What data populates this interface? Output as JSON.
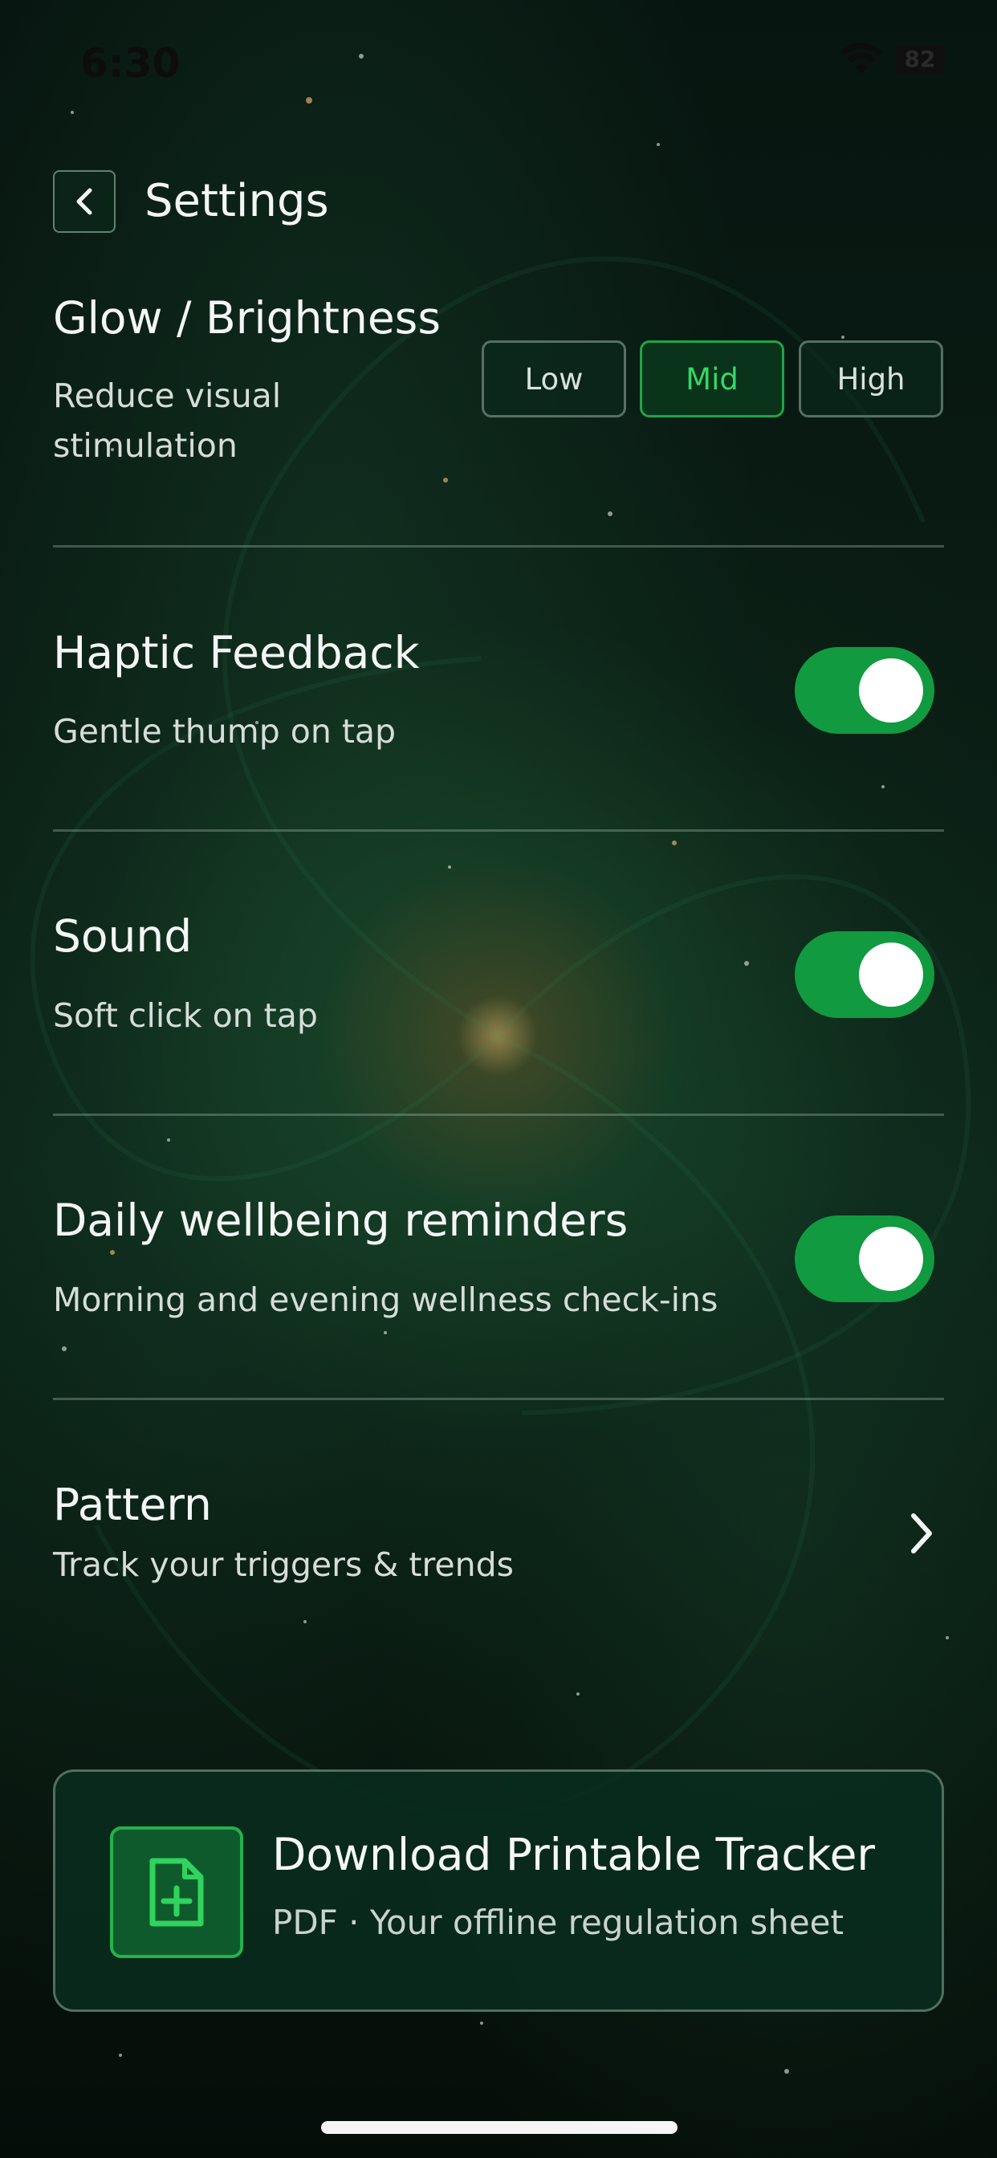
{
  "status_bar": {
    "time": "6:30",
    "battery": "82"
  },
  "header": {
    "title": "Settings"
  },
  "glow": {
    "title": "Glow / Brightness",
    "subtitle_line1": "Reduce visual",
    "subtitle_line2": "stimulation",
    "options": [
      "Low",
      "Mid",
      "High"
    ],
    "selected": "Mid"
  },
  "haptic": {
    "title": "Haptic Feedback",
    "subtitle": "Gentle thump on tap",
    "enabled": true
  },
  "sound": {
    "title": "Sound",
    "subtitle": "Soft click on tap",
    "enabled": true
  },
  "reminders": {
    "title": "Daily wellbeing reminders",
    "subtitle": "Morning and evening wellness check-ins",
    "enabled": true
  },
  "pattern": {
    "title": "Pattern",
    "subtitle": "Track your triggers & trends"
  },
  "download_card": {
    "title": "Download Printable Tracker",
    "subtitle": "PDF · Your offline regulation sheet",
    "icon": "document-plus-icon"
  },
  "colors": {
    "accent": "#119a3f",
    "active_text": "#39d566",
    "icon_border": "#22b34a"
  }
}
